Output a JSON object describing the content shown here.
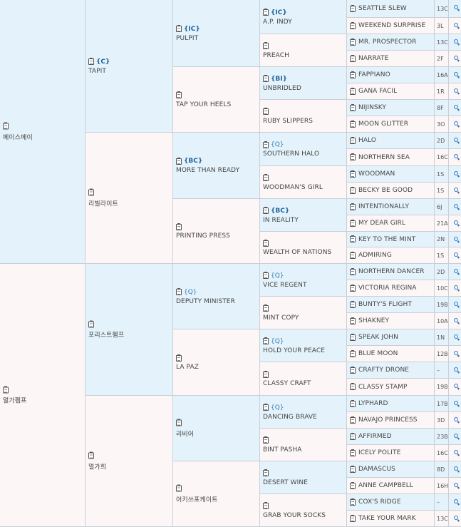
{
  "sire": {
    "code": "",
    "name": "페이스메이"
  },
  "dam": {
    "code": "",
    "name": "멀가펨프"
  },
  "gen2": [
    {
      "code": "{C}",
      "name": "TAPIT"
    },
    {
      "code": "",
      "name": "리빌라이트"
    },
    {
      "code": "",
      "name": "포리스트펨프"
    },
    {
      "code": "",
      "name": "멀가희"
    }
  ],
  "gen3": [
    {
      "code": "{IC}",
      "name": "PULPIT"
    },
    {
      "code": "",
      "name": "TAP YOUR HEELS"
    },
    {
      "code": "{BC}",
      "name": "MORE THAN READY"
    },
    {
      "code": "",
      "name": "PRINTING PRESS"
    },
    {
      "code": "{Q}",
      "name": "DEPUTY MINISTER"
    },
    {
      "code": "",
      "name": "LA PAZ"
    },
    {
      "code": "",
      "name": "리비어"
    },
    {
      "code": "",
      "name": "어키쓰포케이트"
    }
  ],
  "gen4": [
    {
      "code": "{IC}",
      "name": "A.P. INDY"
    },
    {
      "code": "",
      "name": "PREACH"
    },
    {
      "code": "{BI}",
      "name": "UNBRIDLED"
    },
    {
      "code": "",
      "name": "RUBY SLIPPERS"
    },
    {
      "code": "{Q}",
      "name": "SOUTHERN HALO"
    },
    {
      "code": "",
      "name": "WOODMAN'S GIRL"
    },
    {
      "code": "{BC}",
      "name": "IN REALITY"
    },
    {
      "code": "",
      "name": "WEALTH OF NATIONS"
    },
    {
      "code": "{Q}",
      "name": "VICE REGENT"
    },
    {
      "code": "",
      "name": "MINT COPY"
    },
    {
      "code": "{Q}",
      "name": "HOLD YOUR PEACE"
    },
    {
      "code": "",
      "name": "CLASSY CRAFT"
    },
    {
      "code": "{Q}",
      "name": "DANCING BRAVE"
    },
    {
      "code": "",
      "name": "BINT PASHA"
    },
    {
      "code": "",
      "name": "DESERT WINE"
    },
    {
      "code": "",
      "name": "GRAB YOUR SOCKS"
    }
  ],
  "gen5": [
    {
      "name": "SEATTLE SLEW",
      "info": "13C"
    },
    {
      "name": "WEEKEND SURPRISE",
      "info": "3L"
    },
    {
      "name": "MR. PROSPECTOR",
      "info": "13C"
    },
    {
      "name": "NARRATE",
      "info": "2F"
    },
    {
      "name": "FAPPIANO",
      "info": "16A"
    },
    {
      "name": "GANA FACIL",
      "info": "1R"
    },
    {
      "name": "NIJINSKY",
      "info": "8F"
    },
    {
      "name": "MOON GLITTER",
      "info": "3O"
    },
    {
      "name": "HALO",
      "info": "2D"
    },
    {
      "name": "NORTHERN SEA",
      "info": "16C"
    },
    {
      "name": "WOODMAN",
      "info": "1S"
    },
    {
      "name": "BECKY BE GOOD",
      "info": "1S"
    },
    {
      "name": "INTENTIONALLY",
      "info": "6J"
    },
    {
      "name": "MY DEAR GIRL",
      "info": "21A"
    },
    {
      "name": "KEY TO THE MINT",
      "info": "2N"
    },
    {
      "name": "ADMIRING",
      "info": "1S"
    },
    {
      "name": "NORTHERN DANCER",
      "info": "2D"
    },
    {
      "name": "VICTORIA REGINA",
      "info": "10C"
    },
    {
      "name": "BUNTY'S FLIGHT",
      "info": "19B"
    },
    {
      "name": "SHAKNEY",
      "info": "10A"
    },
    {
      "name": "SPEAK JOHN",
      "info": "1N"
    },
    {
      "name": "BLUE MOON",
      "info": "12B"
    },
    {
      "name": "CRAFTY DRONE",
      "info": "–"
    },
    {
      "name": "CLASSY STAMP",
      "info": "19B"
    },
    {
      "name": "LYPHARD",
      "info": "17B"
    },
    {
      "name": "NAVAJO PRINCESS",
      "info": "3D"
    },
    {
      "name": "AFFIRMED",
      "info": "23B"
    },
    {
      "name": "ICELY POLITE",
      "info": "16C"
    },
    {
      "name": "DAMASCUS",
      "info": "8D"
    },
    {
      "name": "ANNE CAMPBELL",
      "info": "16H"
    },
    {
      "name": "COX'S RIDGE",
      "info": "–"
    },
    {
      "name": "TAKE YOUR MARK",
      "info": "13C"
    }
  ],
  "colors": {
    "blue_cell": "#e4f3fb",
    "pink_cell": "#fdf6f6",
    "code_text": "#1f5f99",
    "search_icon": "#2d7bc4"
  }
}
